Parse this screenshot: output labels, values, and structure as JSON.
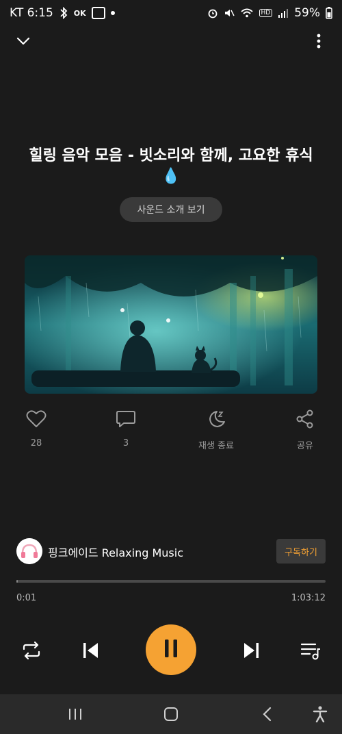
{
  "status_bar": {
    "carrier_time": "KT 6:15",
    "battery": "59%",
    "left_icons": [
      "bluetooth-icon",
      "ok-icon",
      "bank-app-icon",
      "dot-icon"
    ],
    "right_icons": [
      "alarm-icon",
      "mute-icon",
      "wifi-icon",
      "hd-icon",
      "signal-icon"
    ]
  },
  "top_bar": {
    "collapse_icon": "chevron-down-icon",
    "more_icon": "more-vertical-icon"
  },
  "track": {
    "title": "힐링 음악 모음 - 빗소리와 함께, 고요한 휴식 💧",
    "sound_intro_label": "사운드 소개 보기",
    "artwork_description_icon": "rainy-forest-artwork"
  },
  "actions": [
    {
      "icon": "heart-icon",
      "label": "28"
    },
    {
      "icon": "comment-icon",
      "label": "3"
    },
    {
      "icon": "sleep-timer-icon",
      "label": "재생 종료"
    },
    {
      "icon": "share-icon",
      "label": "공유"
    }
  ],
  "channel": {
    "name": "핑크에이드 Relaxing Music",
    "subscribe_label": "구독하기"
  },
  "playback": {
    "current_time": "0:01",
    "total_time": "1:03:12",
    "progress_fraction": 0.0003
  },
  "controls": {
    "repeat_icon": "repeat-icon",
    "prev_icon": "skip-previous-icon",
    "play_icon": "pause-icon",
    "next_icon": "skip-next-icon",
    "queue_icon": "playlist-icon"
  },
  "colors": {
    "accent": "#f5a233",
    "background": "#1b1b1b"
  }
}
